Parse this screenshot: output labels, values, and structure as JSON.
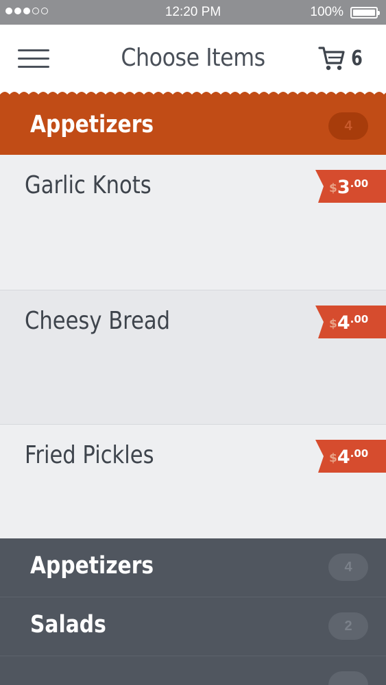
{
  "status_bar": {
    "time": "12:20 PM",
    "battery": "100%"
  },
  "header": {
    "title": "Choose Items",
    "cart_count": "6"
  },
  "active_category": {
    "label": "Appetizers",
    "count": "4"
  },
  "items": [
    {
      "name": "Garlic Knots",
      "currency": "$",
      "dollars": "3",
      "cents": ".00"
    },
    {
      "name": "Cheesy Bread",
      "currency": "$",
      "dollars": "4",
      "cents": ".00"
    },
    {
      "name": "Fried Pickles",
      "currency": "$",
      "dollars": "4",
      "cents": ".00"
    }
  ],
  "categories": [
    {
      "label": "Appetizers",
      "count": "4"
    },
    {
      "label": "Salads",
      "count": "2"
    },
    {
      "label": "",
      "count": ""
    }
  ],
  "colors": {
    "accent": "#c14c16",
    "price_tag": "#d64c2e",
    "dark_panel": "#50565f",
    "text_dark": "#3e444c"
  },
  "icons": {
    "menu": "hamburger-icon",
    "cart": "cart-icon",
    "battery": "battery-icon",
    "signal": "signal-icon"
  }
}
